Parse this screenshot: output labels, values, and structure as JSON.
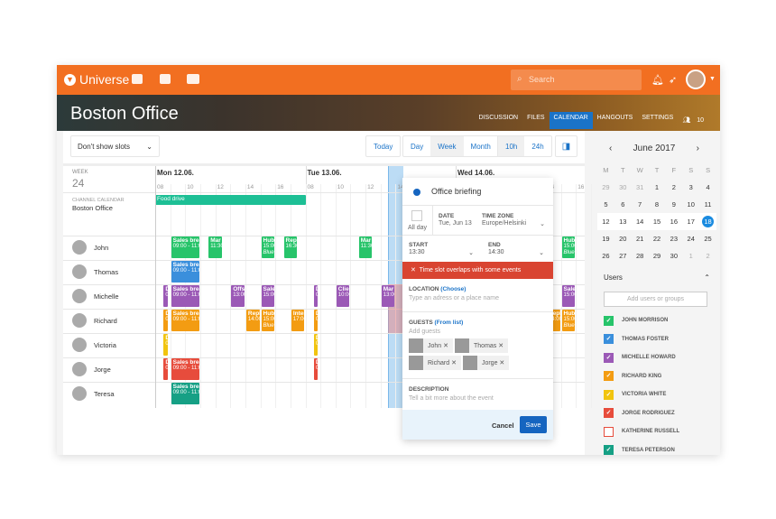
{
  "app": {
    "name": "Universe",
    "search_placeholder": "Search"
  },
  "banner": {
    "title": "Boston Office",
    "tabs": [
      "DISCUSSION",
      "FILES",
      "CALENDAR",
      "HANGOUTS",
      "SETTINGS"
    ],
    "active_tab": "CALENDAR",
    "members": "10"
  },
  "toolbar": {
    "slots": "Don't show slots",
    "today": "Today",
    "day": "Day",
    "week": "Week",
    "month": "Month",
    "h10": "10h",
    "h24": "24h"
  },
  "grid": {
    "week_label": "WEEK",
    "week": "24",
    "channel_label": "CHANNEL CALENDAR",
    "channel": "Boston Office",
    "days": [
      "Mon 12.06.",
      "Tue 13.06.",
      "Wed 14.06."
    ],
    "hours": [
      "08",
      "10",
      "12",
      "14",
      "16"
    ],
    "allday": {
      "title": "Food drive",
      "color": "#1dbf95"
    },
    "people": [
      {
        "name": "John",
        "color": "#27c46a"
      },
      {
        "name": "Thomas",
        "color": "#3a8fdc"
      },
      {
        "name": "Michelle",
        "color": "#9b59b6"
      },
      {
        "name": "Richard",
        "color": "#f39c12"
      },
      {
        "name": "Victoria",
        "color": "#f1c40f"
      },
      {
        "name": "Jorge",
        "color": "#e74c3c"
      },
      {
        "name": "Teresa",
        "color": "#16a085"
      }
    ],
    "events": [
      {
        "p": 0,
        "d": 0,
        "s": 9,
        "e": 11,
        "t": "Sales break",
        "m": "09:00 - 11:00"
      },
      {
        "p": 0,
        "d": 0,
        "s": 11.5,
        "e": 12.5,
        "t": "Mar",
        "m": "11:30"
      },
      {
        "p": 0,
        "d": 0,
        "s": 15,
        "e": 16,
        "t": "Hub",
        "m": "15:00",
        "n": "Blue r"
      },
      {
        "p": 0,
        "d": 0,
        "s": 16.5,
        "e": 17.5,
        "t": "Repl",
        "m": "16:30"
      },
      {
        "p": 0,
        "d": 1,
        "s": 11.5,
        "e": 12.5,
        "t": "Mar",
        "m": "11:30"
      },
      {
        "p": 0,
        "d": 2,
        "s": 15,
        "e": 16,
        "t": "Hub",
        "m": "15:00",
        "n": "Blue r"
      },
      {
        "p": 1,
        "d": 0,
        "s": 9,
        "e": 11,
        "t": "Sales break",
        "m": "09:00 - 11:00"
      },
      {
        "p": 2,
        "d": 0,
        "s": 8.5,
        "e": 8.9,
        "t": "D",
        "m": "0"
      },
      {
        "p": 2,
        "d": 0,
        "s": 9,
        "e": 11,
        "t": "Sales break",
        "m": "09:00 - 11:00"
      },
      {
        "p": 2,
        "d": 0,
        "s": 13,
        "e": 14,
        "t": "Offs",
        "m": "13:00"
      },
      {
        "p": 2,
        "d": 0,
        "s": 15,
        "e": 16,
        "t": "Sales",
        "m": "15:00"
      },
      {
        "p": 2,
        "d": 1,
        "s": 8.5,
        "e": 8.9,
        "t": "D",
        "m": "0"
      },
      {
        "p": 2,
        "d": 1,
        "s": 10,
        "e": 11,
        "t": "Clie",
        "m": "10:00"
      },
      {
        "p": 2,
        "d": 1,
        "s": 13,
        "e": 14,
        "t": "Mar",
        "m": "13:00"
      },
      {
        "p": 2,
        "d": 2,
        "s": 15,
        "e": 16,
        "t": "Sales",
        "m": "15:00"
      },
      {
        "p": 3,
        "d": 0,
        "s": 8.5,
        "e": 8.9,
        "t": "D",
        "m": "0"
      },
      {
        "p": 3,
        "d": 0,
        "s": 9,
        "e": 11,
        "t": "Sales break",
        "m": "09:00 - 11:00"
      },
      {
        "p": 3,
        "d": 0,
        "s": 14,
        "e": 15,
        "t": "Repl",
        "m": "14:00"
      },
      {
        "p": 3,
        "d": 0,
        "s": 15,
        "e": 16,
        "t": "Hub",
        "m": "15:00",
        "n": "Blue r"
      },
      {
        "p": 3,
        "d": 0,
        "s": 17,
        "e": 18,
        "t": "Inter",
        "m": "17:00"
      },
      {
        "p": 3,
        "d": 1,
        "s": 8.5,
        "e": 8.9,
        "t": "D",
        "m": "0"
      },
      {
        "p": 3,
        "d": 2,
        "s": 14,
        "e": 15,
        "t": "Repl",
        "m": "14:00"
      },
      {
        "p": 3,
        "d": 2,
        "s": 15,
        "e": 16,
        "t": "Hub",
        "m": "15:00",
        "n": "Blue r"
      },
      {
        "p": 4,
        "d": 0,
        "s": 8.5,
        "e": 8.9,
        "t": "D",
        "m": "0"
      },
      {
        "p": 4,
        "d": 1,
        "s": 8.5,
        "e": 8.9,
        "t": "D",
        "m": "0"
      },
      {
        "p": 5,
        "d": 0,
        "s": 8.5,
        "e": 8.9,
        "t": "D",
        "m": "0"
      },
      {
        "p": 5,
        "d": 0,
        "s": 9,
        "e": 11,
        "t": "Sales break",
        "m": "09:00 - 11:00"
      },
      {
        "p": 5,
        "d": 1,
        "s": 8.5,
        "e": 8.9,
        "t": "D",
        "m": "0"
      },
      {
        "p": 6,
        "d": 0,
        "s": 9,
        "e": 11,
        "t": "Sales break",
        "m": "09:00 - 11:00"
      }
    ]
  },
  "popup": {
    "title": "Office briefing",
    "color": "#1565c0",
    "allday": "All day",
    "date_label": "DATE",
    "date": "Tue, Jun 13",
    "tz_label": "TIME ZONE",
    "tz": "Europe/Helsinki",
    "start_label": "START",
    "start": "13:30",
    "end_label": "END",
    "end": "14:30",
    "warning": "Time slot overlaps with some events",
    "location_label": "LOCATION",
    "location_link": "(Choose)",
    "location_ph": "Type an adress or a place name",
    "guests_label": "GUESTS",
    "guests_link": "(From list)",
    "guests_ph": "Add guests",
    "guests": [
      "John",
      "Thomas",
      "Richard",
      "Jorge"
    ],
    "desc_label": "DESCRIPTION",
    "desc_ph": "Tell a bit more about the event",
    "cancel": "Cancel",
    "save": "Save"
  },
  "minical": {
    "month": "June 2017",
    "weekdays": [
      "M",
      "T",
      "W",
      "T",
      "F",
      "S",
      "S"
    ],
    "days": [
      "29",
      "30",
      "31",
      "1",
      "2",
      "3",
      "4",
      "5",
      "6",
      "7",
      "8",
      "9",
      "10",
      "11",
      "12",
      "13",
      "14",
      "15",
      "16",
      "17",
      "18",
      "19",
      "20",
      "21",
      "22",
      "23",
      "24",
      "25",
      "26",
      "27",
      "28",
      "29",
      "30",
      "1",
      "2"
    ],
    "selected": "18"
  },
  "users": {
    "title": "Users",
    "placeholder": "Add users or groups",
    "list": [
      {
        "name": "JOHN MORRISON",
        "color": "#27c46a",
        "checked": true
      },
      {
        "name": "THOMAS FOSTER",
        "color": "#3a8fdc",
        "checked": true
      },
      {
        "name": "MICHELLE HOWARD",
        "color": "#9b59b6",
        "checked": true
      },
      {
        "name": "RICHARD KING",
        "color": "#f39c12",
        "checked": true
      },
      {
        "name": "VICTORIA WHITE",
        "color": "#f1c40f",
        "checked": true
      },
      {
        "name": "JORGE RODRIGUEZ",
        "color": "#e74c3c",
        "checked": true
      },
      {
        "name": "KATHERINE RUSSELL",
        "color": "#e74c3c",
        "checked": false
      },
      {
        "name": "TERESA PETERSON",
        "color": "#16a085",
        "checked": true
      }
    ]
  }
}
